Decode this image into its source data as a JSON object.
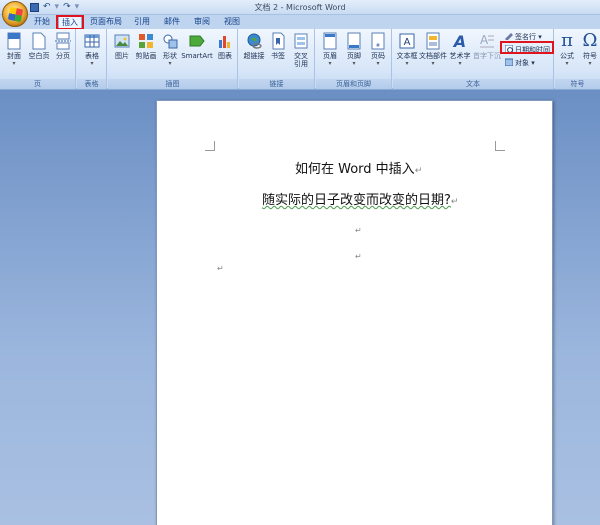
{
  "window": {
    "title": "文档 2 - Microsoft Word"
  },
  "qat": {
    "undo": "↶",
    "redo": "↷",
    "more": "▾"
  },
  "tabs": [
    {
      "label": "开始"
    },
    {
      "label": "插入"
    },
    {
      "label": "页面布局"
    },
    {
      "label": "引用"
    },
    {
      "label": "邮件"
    },
    {
      "label": "审阅"
    },
    {
      "label": "视图"
    }
  ],
  "ribbon": {
    "groups": {
      "pages": "页",
      "tables": "表格",
      "illustrations": "插图",
      "links": "链接",
      "header_footer": "页眉和页脚",
      "text": "文本",
      "symbols": "符号"
    },
    "buttons": {
      "cover": "封面",
      "blank_page": "空白页",
      "page_break": "分页",
      "table": "表格",
      "picture": "图片",
      "clip_art": "剪贴画",
      "shapes": "形状",
      "smartart": "SmartArt",
      "chart": "图表",
      "hyperlink": "超链接",
      "bookmark": "书签",
      "cross_ref_1": "交叉",
      "cross_ref_2": "引用",
      "header": "页眉",
      "footer": "页脚",
      "page_number": "页码",
      "text_box": "文本框",
      "quick_parts": "文档部件",
      "wordart": "艺术字",
      "drop_cap": "首字下沉",
      "signature_line": "签名行",
      "date_time": "日期和时间",
      "object": "对象",
      "equation": "公式",
      "symbol": "符号",
      "dropdown": "▾"
    }
  },
  "document": {
    "line1": "如何在 Word 中插入",
    "line2": "随实际的日子改变而改变的日期?",
    "para_mark": "↵"
  },
  "colors": {
    "highlight": "#e0141e",
    "ribbon_text": "#15428b",
    "doc_bg": "#8aaad6"
  }
}
